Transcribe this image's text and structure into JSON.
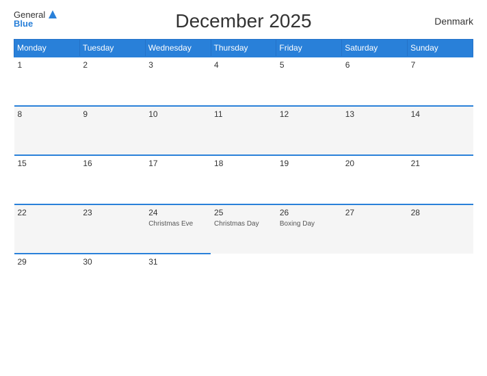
{
  "header": {
    "title": "December 2025",
    "country": "Denmark",
    "logo_general": "General",
    "logo_blue": "Blue"
  },
  "weekdays": [
    "Monday",
    "Tuesday",
    "Wednesday",
    "Thursday",
    "Friday",
    "Saturday",
    "Sunday"
  ],
  "rows": [
    [
      {
        "day": "1",
        "event": ""
      },
      {
        "day": "2",
        "event": ""
      },
      {
        "day": "3",
        "event": ""
      },
      {
        "day": "4",
        "event": ""
      },
      {
        "day": "5",
        "event": ""
      },
      {
        "day": "6",
        "event": ""
      },
      {
        "day": "7",
        "event": ""
      }
    ],
    [
      {
        "day": "8",
        "event": ""
      },
      {
        "day": "9",
        "event": ""
      },
      {
        "day": "10",
        "event": ""
      },
      {
        "day": "11",
        "event": ""
      },
      {
        "day": "12",
        "event": ""
      },
      {
        "day": "13",
        "event": ""
      },
      {
        "day": "14",
        "event": ""
      }
    ],
    [
      {
        "day": "15",
        "event": ""
      },
      {
        "day": "16",
        "event": ""
      },
      {
        "day": "17",
        "event": ""
      },
      {
        "day": "18",
        "event": ""
      },
      {
        "day": "19",
        "event": ""
      },
      {
        "day": "20",
        "event": ""
      },
      {
        "day": "21",
        "event": ""
      }
    ],
    [
      {
        "day": "22",
        "event": ""
      },
      {
        "day": "23",
        "event": ""
      },
      {
        "day": "24",
        "event": "Christmas Eve"
      },
      {
        "day": "25",
        "event": "Christmas Day"
      },
      {
        "day": "26",
        "event": "Boxing Day"
      },
      {
        "day": "27",
        "event": ""
      },
      {
        "day": "28",
        "event": ""
      }
    ],
    [
      {
        "day": "29",
        "event": ""
      },
      {
        "day": "30",
        "event": ""
      },
      {
        "day": "31",
        "event": ""
      },
      {
        "day": "",
        "event": ""
      },
      {
        "day": "",
        "event": ""
      },
      {
        "day": "",
        "event": ""
      },
      {
        "day": "",
        "event": ""
      }
    ]
  ]
}
